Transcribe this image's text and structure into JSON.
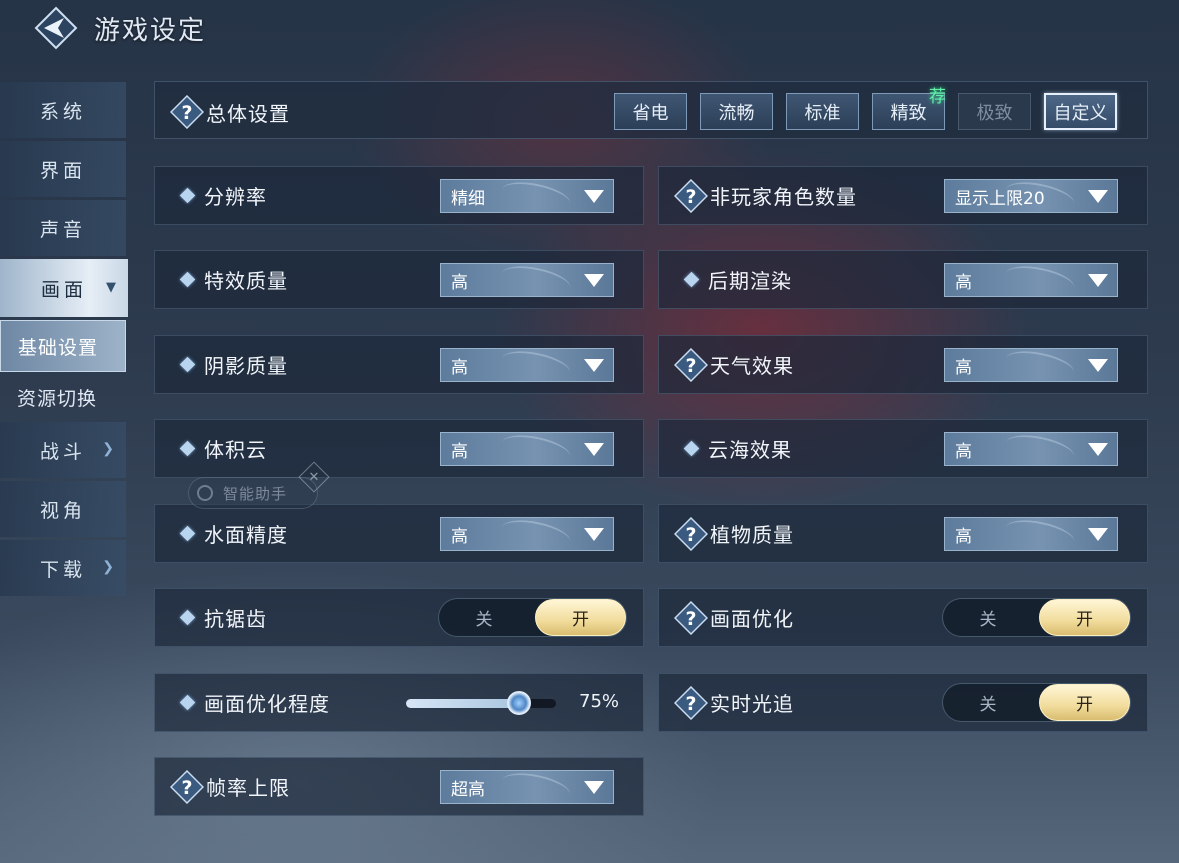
{
  "header": {
    "title": "游戏设定"
  },
  "sidebar": {
    "items": [
      {
        "label": "系统"
      },
      {
        "label": "界面"
      },
      {
        "label": "声音"
      },
      {
        "label": "画面"
      },
      {
        "label": "战斗"
      },
      {
        "label": "视角"
      },
      {
        "label": "下载"
      }
    ],
    "subitems": [
      {
        "label": "基础设置"
      },
      {
        "label": "资源切换"
      }
    ]
  },
  "overall": {
    "label": "总体设置",
    "presets": [
      "省电",
      "流畅",
      "标准",
      "精致",
      "极致",
      "自定义"
    ],
    "recommend_badge": "荐",
    "selected": "自定义",
    "disabled": "极致"
  },
  "settings": {
    "resolution": {
      "label": "分辨率",
      "value": "精细"
    },
    "npc_count": {
      "label": "非玩家角色数量",
      "value": "显示上限20"
    },
    "effects_quality": {
      "label": "特效质量",
      "value": "高"
    },
    "post_render": {
      "label": "后期渲染",
      "value": "高"
    },
    "shadow_quality": {
      "label": "阴影质量",
      "value": "高"
    },
    "weather": {
      "label": "天气效果",
      "value": "高"
    },
    "volumetric_cloud": {
      "label": "体积云",
      "value": "高"
    },
    "cloud_sea": {
      "label": "云海效果",
      "value": "高"
    },
    "water_precision": {
      "label": "水面精度",
      "value": "高"
    },
    "plant_quality": {
      "label": "植物质量",
      "value": "高"
    },
    "antialias": {
      "label": "抗锯齿",
      "off": "关",
      "on": "开",
      "state": "on"
    },
    "image_opt": {
      "label": "画面优化",
      "off": "关",
      "on": "开",
      "state": "on"
    },
    "image_opt_level": {
      "label": "画面优化程度",
      "value_text": "75%",
      "value": 0.75
    },
    "realtime_rt": {
      "label": "实时光追",
      "off": "关",
      "on": "开",
      "state": "on"
    },
    "fps_limit": {
      "label": "帧率上限",
      "value": "超高"
    }
  },
  "assistant": {
    "label": "智能助手"
  },
  "colors": {
    "accent_gold": "#f1dc9c",
    "recommend_green": "#5ff0a8",
    "panel_bg": "#1c283a"
  }
}
